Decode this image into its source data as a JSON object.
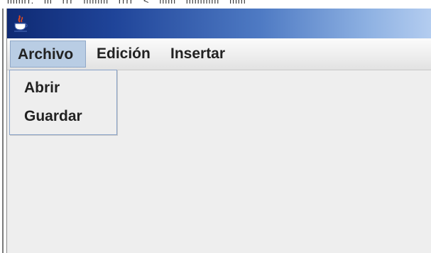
{
  "window": {
    "title": "",
    "title_gradient": [
      "#0f2a73",
      "#b4cdf0"
    ],
    "icon": "java-coffee-cup-icon"
  },
  "menubar": {
    "items": [
      {
        "label": "Archivo",
        "active": true
      },
      {
        "label": "Edición",
        "active": false
      },
      {
        "label": "Insertar",
        "active": false
      }
    ]
  },
  "archivo_menu": {
    "items": [
      {
        "label": "Abrir"
      },
      {
        "label": "Guardar"
      }
    ]
  },
  "colors": {
    "active_menu_bg": "#b9cde4",
    "popup_border": "#8aa3c7",
    "window_bg": "#eeeeee"
  }
}
